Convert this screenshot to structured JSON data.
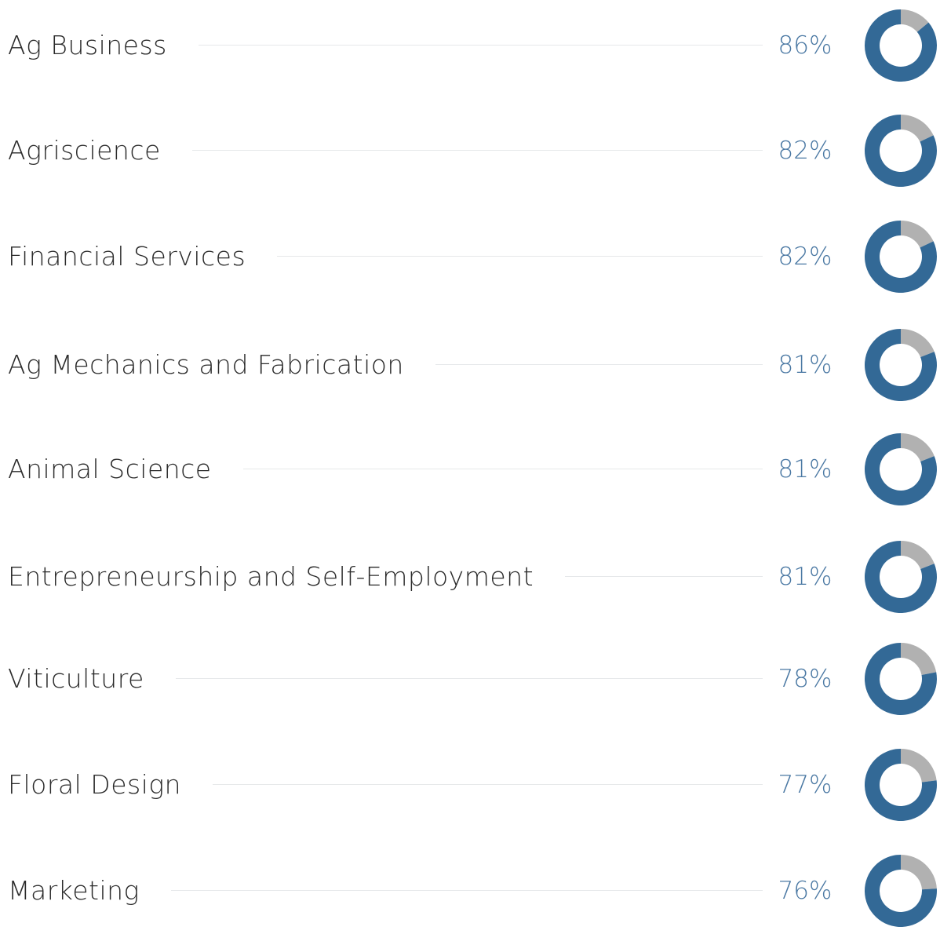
{
  "colors": {
    "filled": "#336996",
    "remaining": "#b1b1b1",
    "value_text": "#4a78a3",
    "label_text": "#2b2b2b",
    "leader_line": "#e6e8ea"
  },
  "chart_data": {
    "type": "pie",
    "categories": [
      "Ag Business",
      "Agriscience",
      "Financial Services",
      "Ag Mechanics and Fabrication",
      "Animal Science",
      "Entrepreneurship and Self-Employment",
      "Viticulture",
      "Floral Design",
      "Marketing"
    ],
    "values": [
      86,
      82,
      82,
      81,
      81,
      81,
      78,
      77,
      76
    ],
    "value_labels": [
      "86%",
      "82%",
      "82%",
      "81%",
      "81%",
      "81%",
      "78%",
      "77%",
      "76%"
    ],
    "max": 100
  }
}
